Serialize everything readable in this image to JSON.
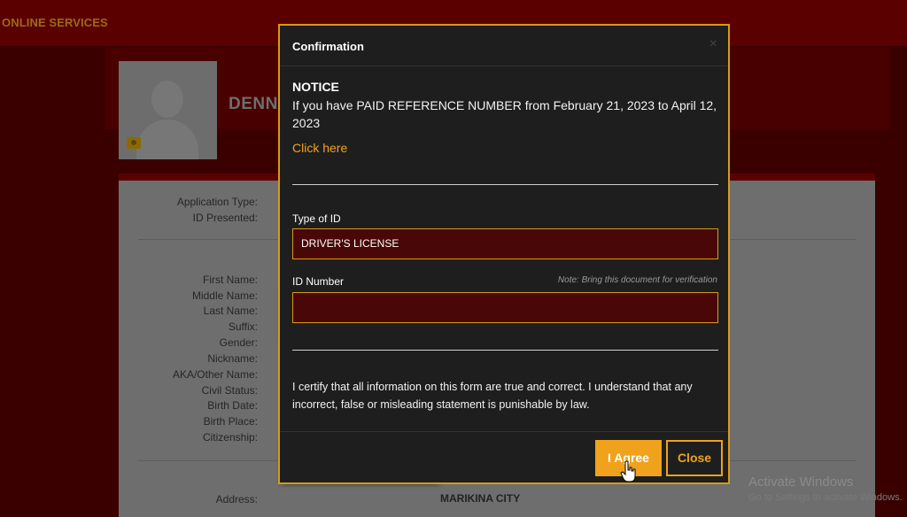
{
  "header": {
    "brand": "ONLINE SERVICES"
  },
  "profile": {
    "name": "DENN"
  },
  "background_form": {
    "labels": {
      "application_type": "Application Type:",
      "id_presented": "ID Presented:",
      "first_name": "First Name:",
      "middle_name": "Middle Name:",
      "last_name": "Last Name:",
      "suffix": "Suffix:",
      "gender": "Gender:",
      "nickname": "Nickname:",
      "aka": "AKA/Other Name:",
      "civil_status": "Civil Status:",
      "birth_date": "Birth Date:",
      "birth_place": "Birth Place:",
      "citizenship": "Citizenship:",
      "address": "Address:"
    },
    "address_value": "MARIKINA CITY"
  },
  "modal": {
    "title": "Confirmation",
    "close_x": "×",
    "notice_title": "NOTICE",
    "notice_text": "If you have PAID REFERENCE NUMBER from February 21, 2023 to April 12, 2023",
    "click_here": "Click here",
    "type_of_id_label": "Type of ID",
    "type_of_id_value": "DRIVER'S LICENSE",
    "id_number_label": "ID Number",
    "id_number_note": "Note: Bring this document for verification",
    "certify_text": "I certify that all information on this form are true and correct. I understand that any incorrect, false or misleading statement is punishable by law.",
    "agree_button": "I Agree",
    "close_button": "Close"
  },
  "watermark": {
    "line1": "Activate Windows",
    "line2": "Go to Settings to activate Windows."
  },
  "colors": {
    "accent": "#f0a21c",
    "field_bg": "#4a0707",
    "modal_bg": "#1e1e1e",
    "page_bg": "#3a0000"
  }
}
